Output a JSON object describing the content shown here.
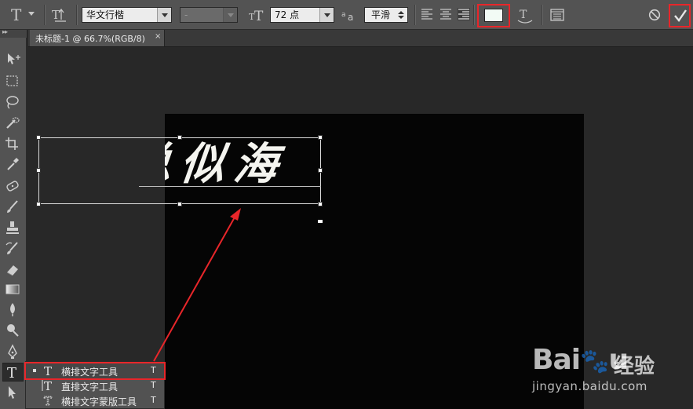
{
  "options_bar": {
    "font_family": "华文行楷",
    "font_style": "-",
    "font_size": "72 点",
    "aa_icon_label": "a",
    "antialias": "平滑",
    "text_color": "#f2fbf5",
    "highlight_color": "#e8262a"
  },
  "tab": {
    "title": "未标题-1 @ 66.7%(RGB/8)",
    "close": "×"
  },
  "canvas": {
    "text": "总似海",
    "document_color": "#050505"
  },
  "flyout": {
    "items": [
      {
        "label": "横排文字工具",
        "shortcut": "T"
      },
      {
        "label": "直排文字工具",
        "shortcut": "T"
      },
      {
        "label": "横排文字蒙版工具",
        "shortcut": "T"
      }
    ]
  },
  "watermark": {
    "logo": "Bai",
    "logo_end": "u",
    "cn": "经验",
    "url": "jingyan.baidu.com"
  },
  "icons": [
    "type-tool-icon",
    "text-orientation-icon",
    "font-size-icon",
    "align-left-icon",
    "align-center-icon",
    "align-right-icon",
    "warp-text-icon",
    "character-panel-icon",
    "cancel-icon",
    "commit-check-icon",
    "move-tool-icon",
    "marquee-icon",
    "lasso-icon",
    "quick-select-icon",
    "crop-icon",
    "eyedropper-icon",
    "healing-brush-icon",
    "brush-icon",
    "clone-stamp-icon",
    "history-brush-icon",
    "eraser-icon",
    "gradient-icon",
    "blur-icon",
    "dodge-icon",
    "pen-icon",
    "type-icon",
    "path-select-icon"
  ]
}
